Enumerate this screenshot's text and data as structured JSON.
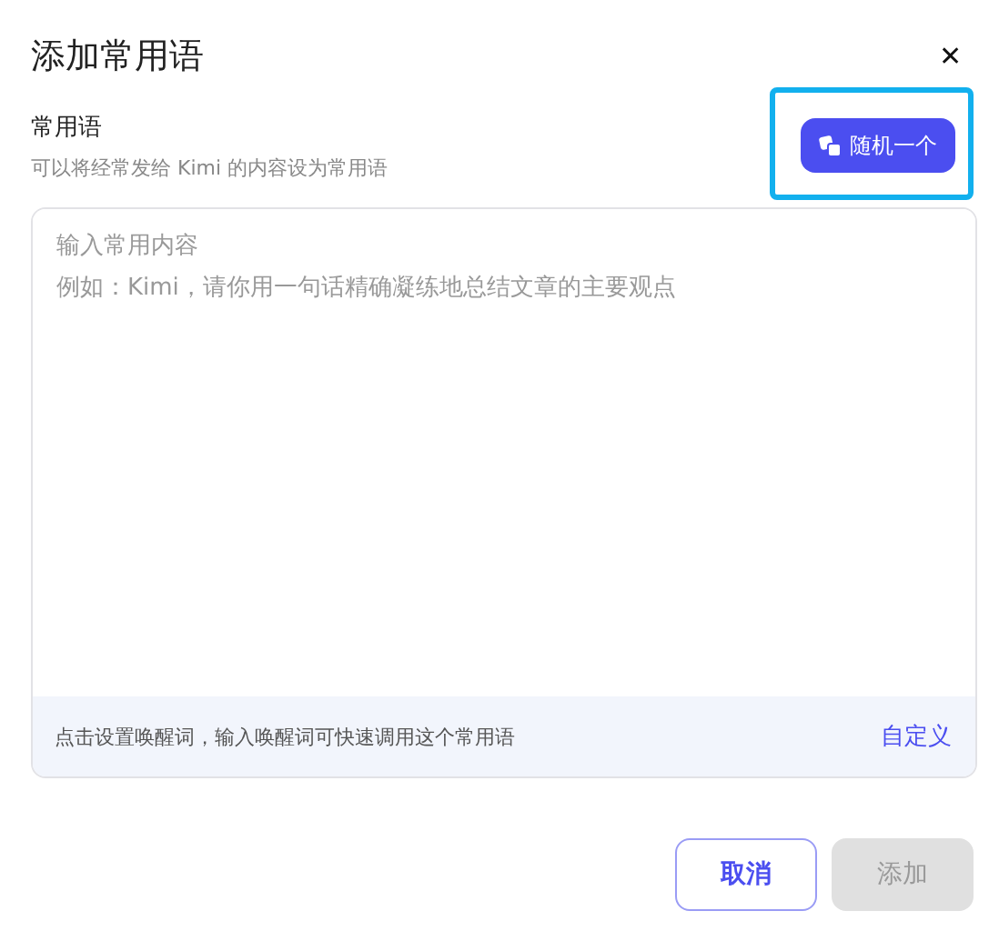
{
  "dialog": {
    "title": "添加常用语",
    "close": "✕"
  },
  "section": {
    "label": "常用语",
    "description": "可以将经常发给 Kimi 的内容设为常用语"
  },
  "random_button": {
    "label": "随机一个",
    "highlighted": true
  },
  "content_field": {
    "placeholder": "输入常用内容",
    "example": "例如：Kimi，请你用一句话精确凝练地总结文章的主要观点"
  },
  "wake_word": {
    "hint": "点击设置唤醒词，输入唤醒词可快速调用这个常用语",
    "link": "自定义"
  },
  "buttons": [
    {
      "label": "取消",
      "kind": "secondary",
      "disabled": false
    },
    {
      "label": "添加",
      "kind": "primary",
      "disabled": true
    }
  ]
}
